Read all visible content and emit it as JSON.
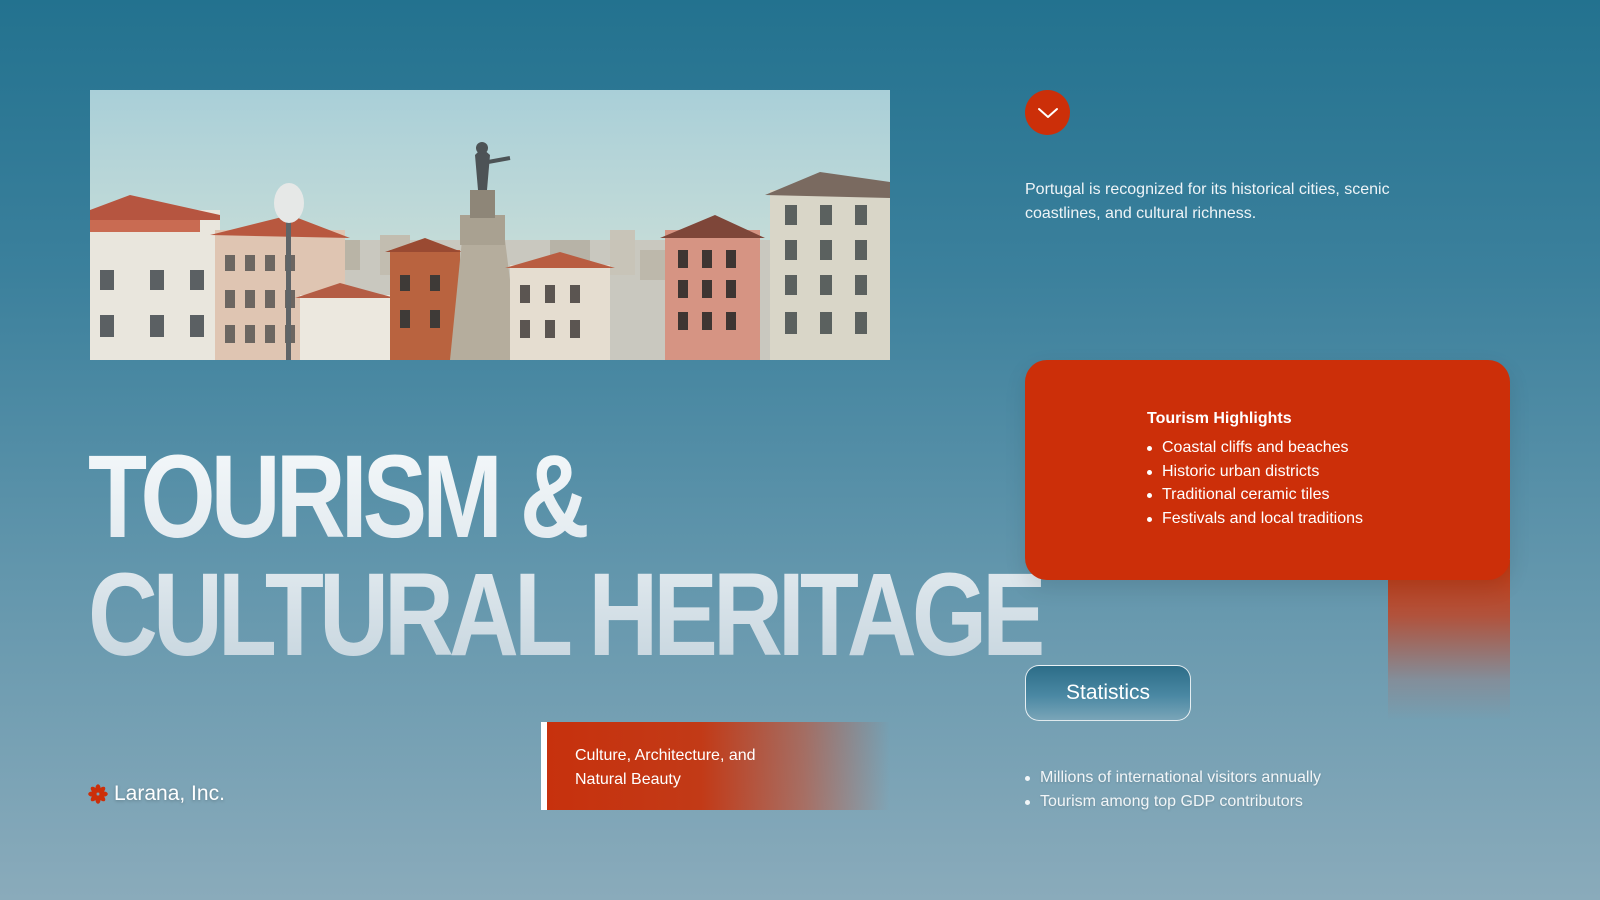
{
  "headline": {
    "line1": "TOURISM &",
    "line2": "CULTURAL HERITAGE"
  },
  "photo": {
    "description_icon": "city-square-photo"
  },
  "brand": {
    "icon": "asterisk-flower-icon",
    "name": "Larana, Inc."
  },
  "tag": {
    "line1": "Culture, Architecture, and",
    "line2": "Natural Beauty"
  },
  "intro": {
    "line1": "Portugal is recognized for its historical cities, scenic",
    "line2": "coastlines, and cultural richness."
  },
  "highlights": {
    "title": "Tourism Highlights",
    "items": [
      "Coastal cliffs and beaches",
      "Historic urban districts",
      "Traditional ceramic tiles",
      "Festivals and local traditions"
    ]
  },
  "statistics": {
    "button_label": "Statistics",
    "items": [
      "Millions of international visitors annually",
      "Tourism among top GDP contributors"
    ]
  },
  "colors": {
    "accent": "#cc2f09",
    "background_top": "#23728f",
    "background_bottom": "#8aabbb"
  }
}
